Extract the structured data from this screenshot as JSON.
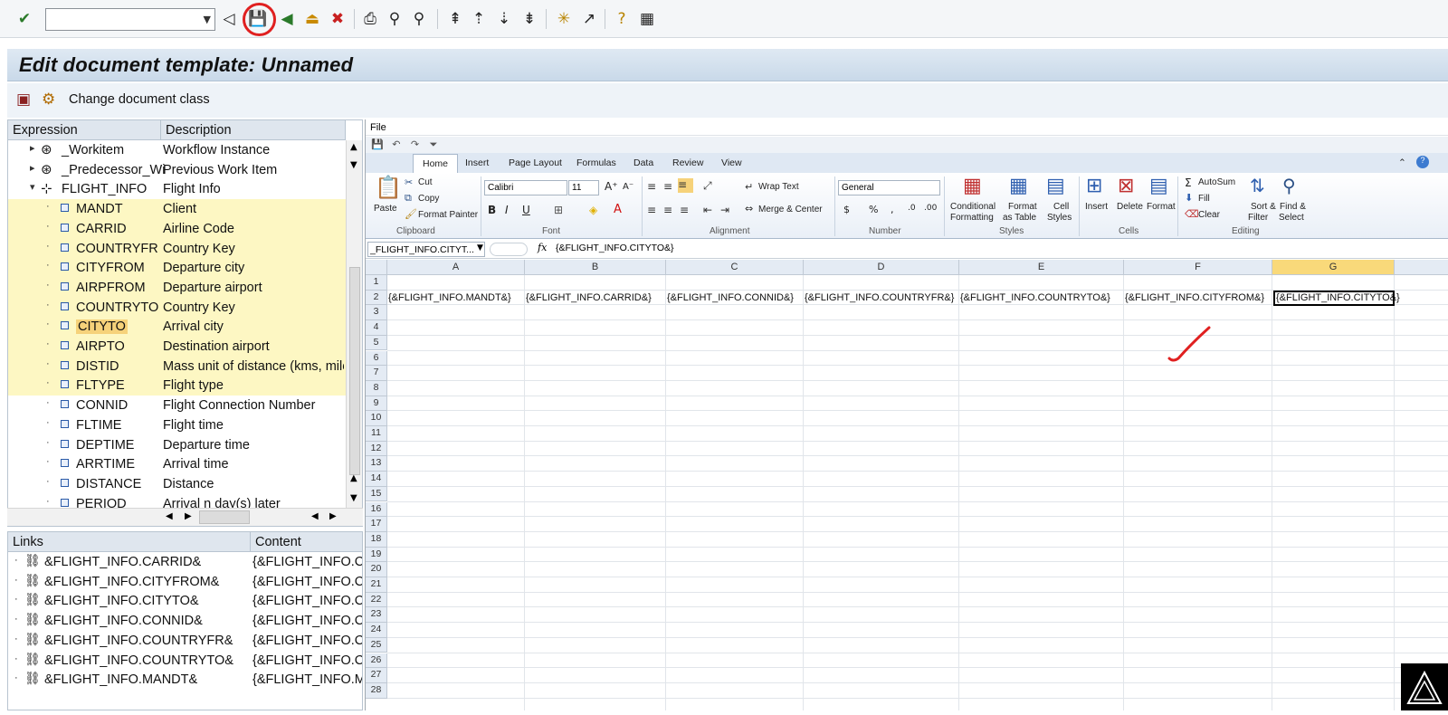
{
  "toolbar": {
    "command_field_value": "",
    "buttons": [
      "enter-icon",
      "back-nav-icon",
      "save-icon",
      "back-icon",
      "exit-icon",
      "cancel-icon",
      "print-icon",
      "find-icon",
      "find-next-icon",
      "first-page-icon",
      "prev-page-icon",
      "next-page-icon",
      "last-page-icon",
      "new-session-icon",
      "shortcut-icon",
      "help-icon",
      "customize-layout-icon"
    ]
  },
  "title": "Edit document template: Unnamed",
  "appbar": {
    "change_doc_class": "Change document class"
  },
  "tree": {
    "headers": {
      "expression": "Expression",
      "description": "Description"
    },
    "rows": [
      {
        "expr": "_Workitem",
        "desc": "Workflow Instance",
        "level": 0,
        "icon": "object-icon",
        "highlight": false
      },
      {
        "expr": "_Predecessor_Wi",
        "desc": "Previous Work Item",
        "level": 0,
        "icon": "object-icon",
        "highlight": false
      },
      {
        "expr": "FLIGHT_INFO",
        "desc": "Flight Info",
        "level": 0,
        "icon": "structure-icon",
        "highlight": false
      },
      {
        "expr": "MANDT",
        "desc": "Client",
        "level": 1,
        "icon": "field-icon",
        "highlight": true
      },
      {
        "expr": "CARRID",
        "desc": "Airline Code",
        "level": 1,
        "icon": "field-icon",
        "highlight": true
      },
      {
        "expr": "COUNTRYFR",
        "desc": "Country Key",
        "level": 1,
        "icon": "field-icon",
        "highlight": true
      },
      {
        "expr": "CITYFROM",
        "desc": "Departure city",
        "level": 1,
        "icon": "field-icon",
        "highlight": true
      },
      {
        "expr": "AIRPFROM",
        "desc": "Departure airport",
        "level": 1,
        "icon": "field-icon",
        "highlight": true
      },
      {
        "expr": "COUNTRYTO",
        "desc": "Country Key",
        "level": 1,
        "icon": "field-icon",
        "highlight": true
      },
      {
        "expr": "CITYTO",
        "desc": "Arrival city",
        "level": 1,
        "icon": "field-icon",
        "highlight": true,
        "selected": true
      },
      {
        "expr": "AIRPTO",
        "desc": "Destination airport",
        "level": 1,
        "icon": "field-icon",
        "highlight": true
      },
      {
        "expr": "DISTID",
        "desc": "Mass unit of distance (kms, mile",
        "level": 1,
        "icon": "field-icon",
        "highlight": true
      },
      {
        "expr": "FLTYPE",
        "desc": "Flight type",
        "level": 1,
        "icon": "field-icon",
        "highlight": true
      },
      {
        "expr": "CONNID",
        "desc": "Flight Connection Number",
        "level": 1,
        "icon": "field-icon",
        "highlight": false
      },
      {
        "expr": "FLTIME",
        "desc": "Flight time",
        "level": 1,
        "icon": "field-icon",
        "highlight": false
      },
      {
        "expr": "DEPTIME",
        "desc": "Departure time",
        "level": 1,
        "icon": "field-icon",
        "highlight": false
      },
      {
        "expr": "ARRTIME",
        "desc": "Arrival time",
        "level": 1,
        "icon": "field-icon",
        "highlight": false
      },
      {
        "expr": "DISTANCE",
        "desc": "Distance",
        "level": 1,
        "icon": "field-icon",
        "highlight": false
      },
      {
        "expr": "PERIOD",
        "desc": "Arrival n day(s) later",
        "level": 1,
        "icon": "field-icon",
        "highlight": false
      }
    ]
  },
  "links": {
    "headers": {
      "links": "Links",
      "content": "Content"
    },
    "rows": [
      {
        "name": "&FLIGHT_INFO.CARRID&",
        "content": "{&FLIGHT_INFO.CARRID&}"
      },
      {
        "name": "&FLIGHT_INFO.CITYFROM&",
        "content": "{&FLIGHT_INFO.CITYFROM&}"
      },
      {
        "name": "&FLIGHT_INFO.CITYTO&",
        "content": "{&FLIGHT_INFO.CITYTO&}"
      },
      {
        "name": "&FLIGHT_INFO.CONNID&",
        "content": "{&FLIGHT_INFO.CONNID&}"
      },
      {
        "name": "&FLIGHT_INFO.COUNTRYFR&",
        "content": "{&FLIGHT_INFO.COUNTRYFR&}"
      },
      {
        "name": "&FLIGHT_INFO.COUNTRYTO&",
        "content": "{&FLIGHT_INFO.COUNTRYTO&}"
      },
      {
        "name": "&FLIGHT_INFO.MANDT&",
        "content": "{&FLIGHT_INFO.MANDT&}"
      }
    ]
  },
  "excel": {
    "file_label": "File",
    "tabs": [
      "Home",
      "Insert",
      "Page Layout",
      "Formulas",
      "Data",
      "Review",
      "View"
    ],
    "ribbon": {
      "paste": "Paste",
      "cut": "Cut",
      "copy": "Copy",
      "format_painter": "Format Painter",
      "clipboard": "Clipboard",
      "font_name": "Calibri",
      "font_size": "11",
      "font": "Font",
      "wrap_text": "Wrap Text",
      "merge_center": "Merge & Center",
      "alignment": "Alignment",
      "number_format": "General",
      "number": "Number",
      "conditional_formatting_1": "Conditional",
      "conditional_formatting_2": "Formatting",
      "format_as_table_1": "Format",
      "format_as_table_2": "as Table",
      "cell_styles_1": "Cell",
      "cell_styles_2": "Styles",
      "styles": "Styles",
      "insert": "Insert",
      "delete": "Delete",
      "format": "Format",
      "cells": "Cells",
      "autosum": "AutoSum",
      "fill": "Fill",
      "clear": "Clear",
      "sort_filter_1": "Sort &",
      "sort_filter_2": "Filter",
      "find_select_1": "Find &",
      "find_select_2": "Select",
      "editing": "Editing"
    },
    "name_box": "_FLIGHT_INFO.CITYT...",
    "fx": "fx",
    "formula": "{&FLIGHT_INFO.CITYTO&}",
    "columns": [
      "A",
      "B",
      "C",
      "D",
      "E",
      "F",
      "G"
    ],
    "rows": [
      "1",
      "2",
      "3",
      "4",
      "5",
      "6",
      "7",
      "8",
      "9",
      "10",
      "11",
      "12",
      "13",
      "14",
      "15",
      "16",
      "17",
      "18",
      "19",
      "20",
      "21",
      "22",
      "23",
      "24",
      "25",
      "26",
      "27",
      "28"
    ],
    "row2": [
      "{&FLIGHT_INFO.MANDT&}",
      "{&FLIGHT_INFO.CARRID&}",
      "{&FLIGHT_INFO.CONNID&}",
      "{&FLIGHT_INFO.COUNTRYFR&}",
      "{&FLIGHT_INFO.COUNTRYTO&}",
      "{&FLIGHT_INFO.CITYFROM&}",
      "{&FLIGHT_INFO.CITYTO&}"
    ]
  },
  "colors": {
    "highlight_row": "#fdf7c3",
    "annotation_red": "#e02020",
    "title_bar": "#c9d9e9"
  }
}
